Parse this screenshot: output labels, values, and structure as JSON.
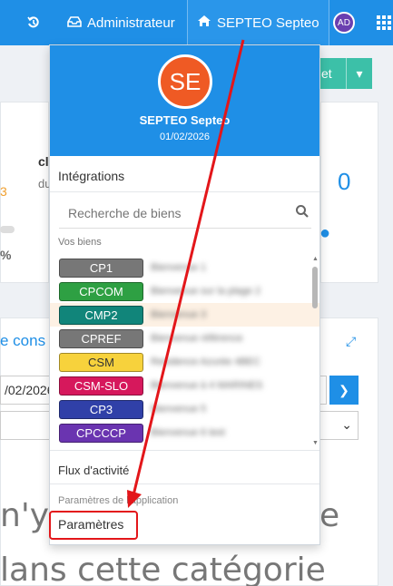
{
  "topbar": {
    "admin_label": "Administrateur",
    "user_label": "SEPTEO Septeo",
    "avatar_initials": "AD",
    "color": "#1f8fe6"
  },
  "background": {
    "button_fragment": "et",
    "zero_value": "0",
    "frag_cl": "cl",
    "frag_du": "du",
    "frag_3": "3",
    "frag_pct": "%",
    "link_fragment": "e cons",
    "date_fragment": "/02/2026",
    "text_line1_a": "n'y",
    "text_line1_b": "e",
    "text_line2": "lans cette catégorie"
  },
  "dropdown": {
    "avatar_initials": "SE",
    "name": "SEPTEO Septeo",
    "date": "01/02/2026",
    "integrations_title": "Intégrations",
    "search_placeholder": "Recherche de biens",
    "biens_label": "Vos biens",
    "biens": [
      {
        "code": "CP1",
        "color": "#777777",
        "text": "Bienvenue 1"
      },
      {
        "code": "CPCOM",
        "color": "#2ea043",
        "text": "Bienvenue sur la plage 2"
      },
      {
        "code": "CMP2",
        "color": "#11857a",
        "text": "Bienvenue 3"
      },
      {
        "code": "CPREF",
        "color": "#777777",
        "text": "Bienvenue référence"
      },
      {
        "code": "CSM",
        "color": "#f7d23c",
        "text": "Residence Azurée 4BEC"
      },
      {
        "code": "CSM-SLO",
        "color": "#d6185c",
        "text": "Bienvenue à 4 MARINES"
      },
      {
        "code": "CP3",
        "color": "#3040a8",
        "text": "Bienvenue 5"
      },
      {
        "code": "CPCCCP",
        "color": "#6a34b0",
        "text": "Bienvenue 6 test"
      }
    ],
    "flux_label": "Flux d'activité",
    "params_section_title": "Paramètres de l'application",
    "params_link": "Paramètres"
  }
}
